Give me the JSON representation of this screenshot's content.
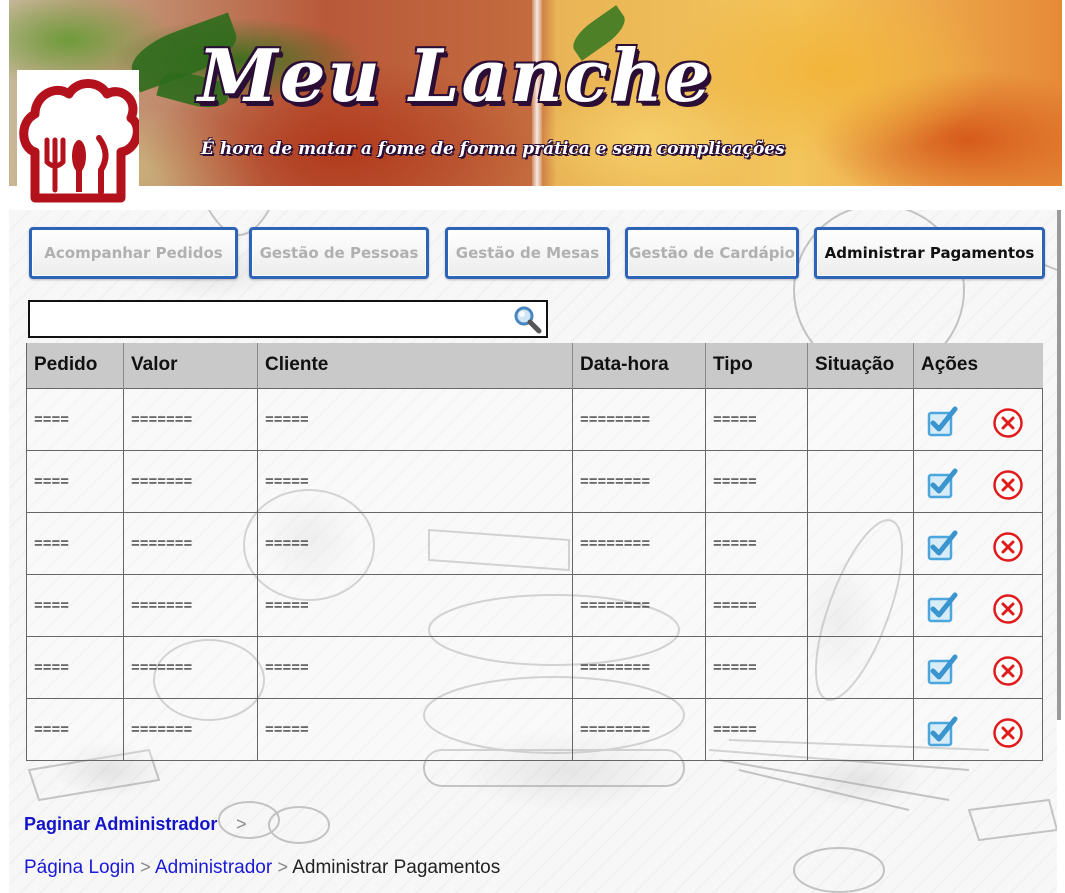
{
  "header": {
    "title": "Meu Lanche",
    "subtitle": "É hora de matar a fome de forma prática e sem complicações"
  },
  "nav": {
    "buttons": [
      {
        "label": "Acompanhar Pedidos",
        "active": false
      },
      {
        "label": "Gestão de Pessoas",
        "active": false
      },
      {
        "label": "Gestão de Mesas",
        "active": false
      },
      {
        "label": "Gestão de Cardápio",
        "active": false
      },
      {
        "label": "Administrar Pagamentos",
        "active": true
      }
    ]
  },
  "search": {
    "value": "",
    "placeholder": "",
    "icon": "magnifier-icon"
  },
  "table": {
    "headers": [
      "Pedido",
      "Valor",
      "Cliente",
      "Data-hora",
      "Tipo",
      "Situação",
      "Ações"
    ],
    "rows": [
      [
        "====",
        "=======",
        "=====",
        "========",
        "=====",
        ""
      ],
      [
        "====",
        "=======",
        "=====",
        "========",
        "=====",
        ""
      ],
      [
        "====",
        "=======",
        "=====",
        "========",
        "=====",
        ""
      ],
      [
        "====",
        "=======",
        "=====",
        "========",
        "=====",
        ""
      ],
      [
        "====",
        "=======",
        "=====",
        "========",
        "=====",
        ""
      ],
      [
        "====",
        "=======",
        "=====",
        "========",
        "=====",
        ""
      ]
    ],
    "row_actions": [
      "checkbox-confirm-icon",
      "cancel-circle-icon"
    ]
  },
  "footer": {
    "admin_link": "Paginar Administrador",
    "separator": ">",
    "breadcrumb": {
      "login": "Página Login",
      "admin": "Administrador",
      "current": "Administrar Pagamentos"
    }
  },
  "colors": {
    "button_border": "#2d64b8",
    "link": "#1a1ad6",
    "logo_red": "#b3121c",
    "cancel_red": "#e01b1b",
    "check_blue": "#4aa6dc",
    "header_row": "#c9c9c9"
  }
}
